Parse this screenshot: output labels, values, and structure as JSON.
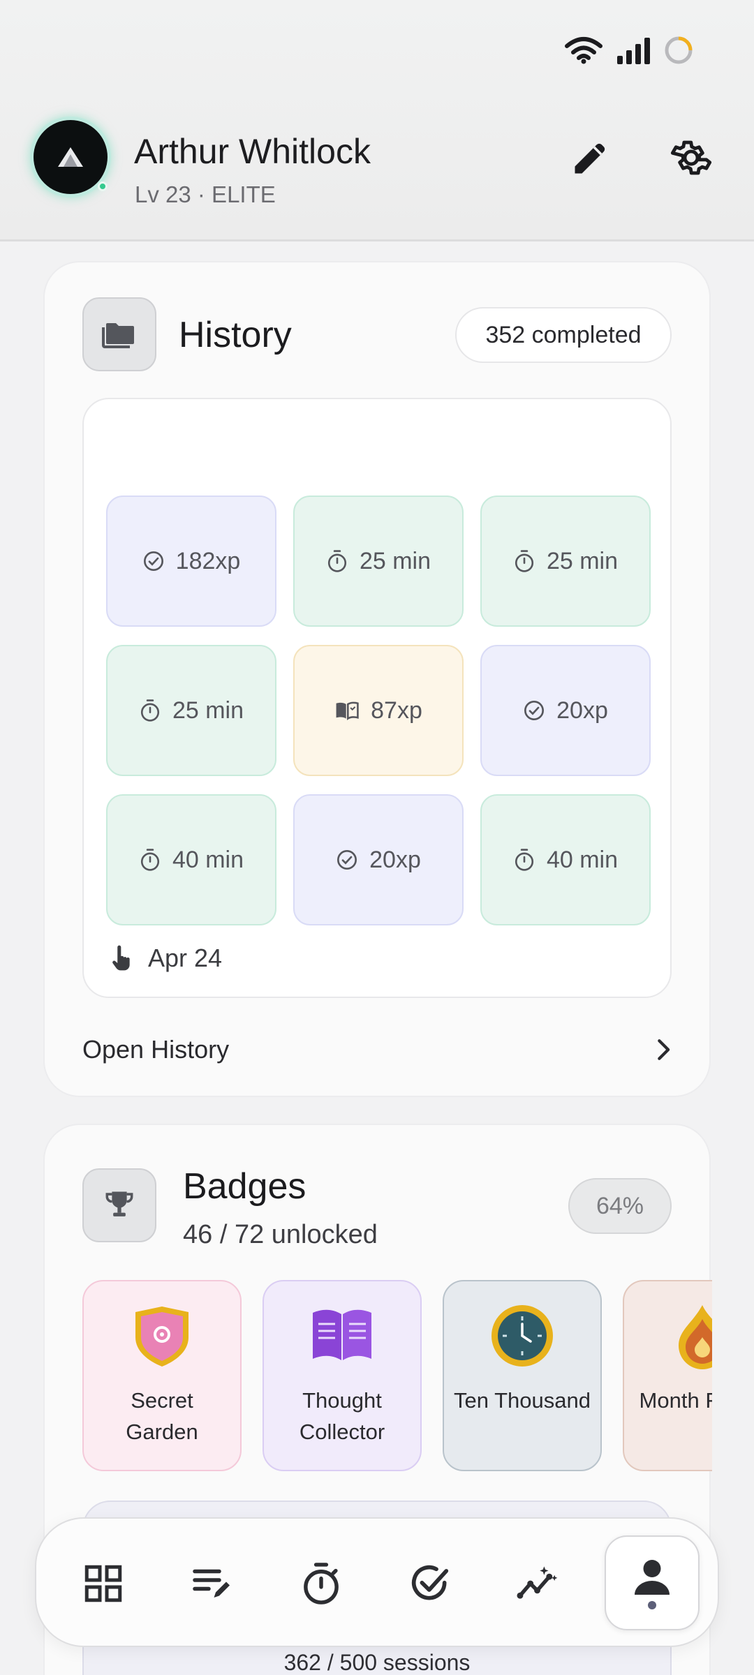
{
  "header": {
    "user_name": "Arthur Whitlock",
    "level": "Lv 23 · ELITE",
    "avatar_icon": "triangle-logo-icon",
    "online_color": "#34c98e"
  },
  "status_bar": {
    "icons": [
      "wifi-icon",
      "signal-icon",
      "loading-ring-icon"
    ]
  },
  "history": {
    "title": "History",
    "completed": "352 completed",
    "tiles": [
      {
        "icon": "check-circle-icon",
        "label": "182xp",
        "tone": "violet"
      },
      {
        "icon": "timer-icon",
        "label": "25 min",
        "tone": "mint"
      },
      {
        "icon": "timer-icon",
        "label": "25 min",
        "tone": "mint"
      },
      {
        "icon": "timer-icon",
        "label": "25 min",
        "tone": "mint"
      },
      {
        "icon": "book-icon",
        "label": "87xp",
        "tone": "amber"
      },
      {
        "icon": "check-circle-icon",
        "label": "20xp",
        "tone": "violet"
      },
      {
        "icon": "timer-icon",
        "label": "40 min",
        "tone": "mint"
      },
      {
        "icon": "check-circle-icon",
        "label": "20xp",
        "tone": "violet"
      },
      {
        "icon": "timer-icon",
        "label": "40 min",
        "tone": "mint"
      }
    ],
    "date": "Apr 24",
    "open_label": "Open History"
  },
  "badges": {
    "title": "Badges",
    "subtitle": "46 / 72 unlocked",
    "percent": "64%",
    "items": [
      {
        "name": "Secret Garden",
        "icon": "shield-icon",
        "tone": "pink"
      },
      {
        "name": "Thought Collector",
        "icon": "open-book-icon",
        "tone": "purple"
      },
      {
        "name": "Ten Thousand",
        "icon": "clock-icon",
        "tone": "slate"
      },
      {
        "name": "Month Flame",
        "icon": "flame-icon",
        "tone": "peach"
      }
    ]
  },
  "sessions": "362 / 500 sessions",
  "nav": {
    "items": [
      "dashboard-icon",
      "journal-edit-icon",
      "timer-icon",
      "check-icon",
      "insights-icon",
      "profile-icon"
    ],
    "active": "profile-icon"
  },
  "colors": {
    "violet_tile": "#eeeffc",
    "mint_tile": "#e8f5ef",
    "amber_tile": "#fdf6e8"
  }
}
